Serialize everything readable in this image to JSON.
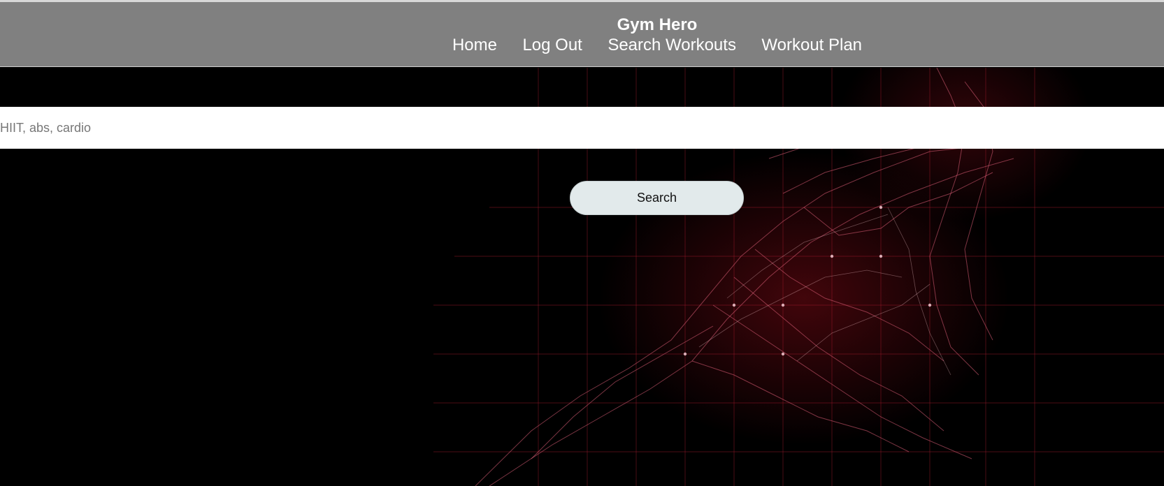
{
  "header": {
    "brand": "Gym Hero",
    "nav": [
      {
        "label": "Home"
      },
      {
        "label": "Log Out"
      },
      {
        "label": "Search Workouts"
      },
      {
        "label": "Workout Plan"
      }
    ]
  },
  "search": {
    "placeholder": "HIIT, abs, cardio",
    "value": "",
    "button_label": "Search"
  },
  "colors": {
    "navbar": "#808080",
    "background": "#000000",
    "button": "#e2eaeb",
    "accent": "#c0283a"
  }
}
